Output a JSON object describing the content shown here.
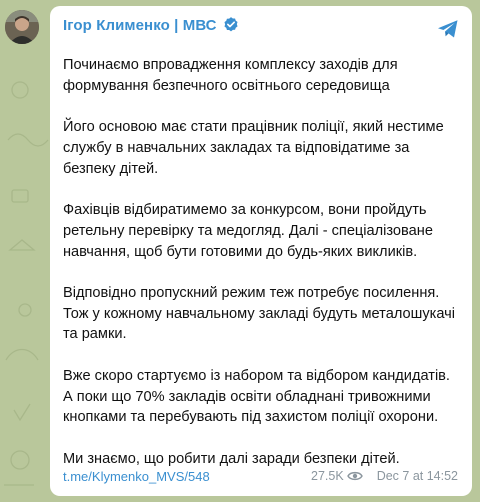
{
  "post": {
    "author": "Ігор Клименко | МВС",
    "paragraphs": [
      "Починаємо впровадження комплексу заходів для формування безпечного освітнього середовища",
      "Його основою має стати працівник поліції, який нестиме службу в навчальних закладах та відповідатиме за безпеку дітей.",
      "Фахівців відбиратимемо за конкурсом, вони пройдуть ретельну перевірку та медогляд. Далі - спеціалізоване навчання, щоб бути готовими до будь-яких викликів.",
      "Відповідно пропускний режим теж потребує посилення. Тож у кожному навчальному закладі будуть металошукачі та рамки.",
      "Вже скоро стартуємо із набором та відбором кандидатів. А поки що 70% закладів освіти обладнані тривожними кнопками та перебувають під захистом поліції охорони.",
      "Ми знаємо, що робити далі заради безпеки дітей."
    ],
    "link": "t.me/Klymenko_MVS/548",
    "views": "27.5K",
    "date": "Dec 7 at 14:52"
  },
  "colors": {
    "background": "#b9c79b",
    "accent": "#3a8fd0",
    "muted": "#8b969e"
  },
  "icons": {
    "verified": "verified-badge-icon",
    "share": "telegram-share-icon",
    "views": "eye-icon"
  }
}
